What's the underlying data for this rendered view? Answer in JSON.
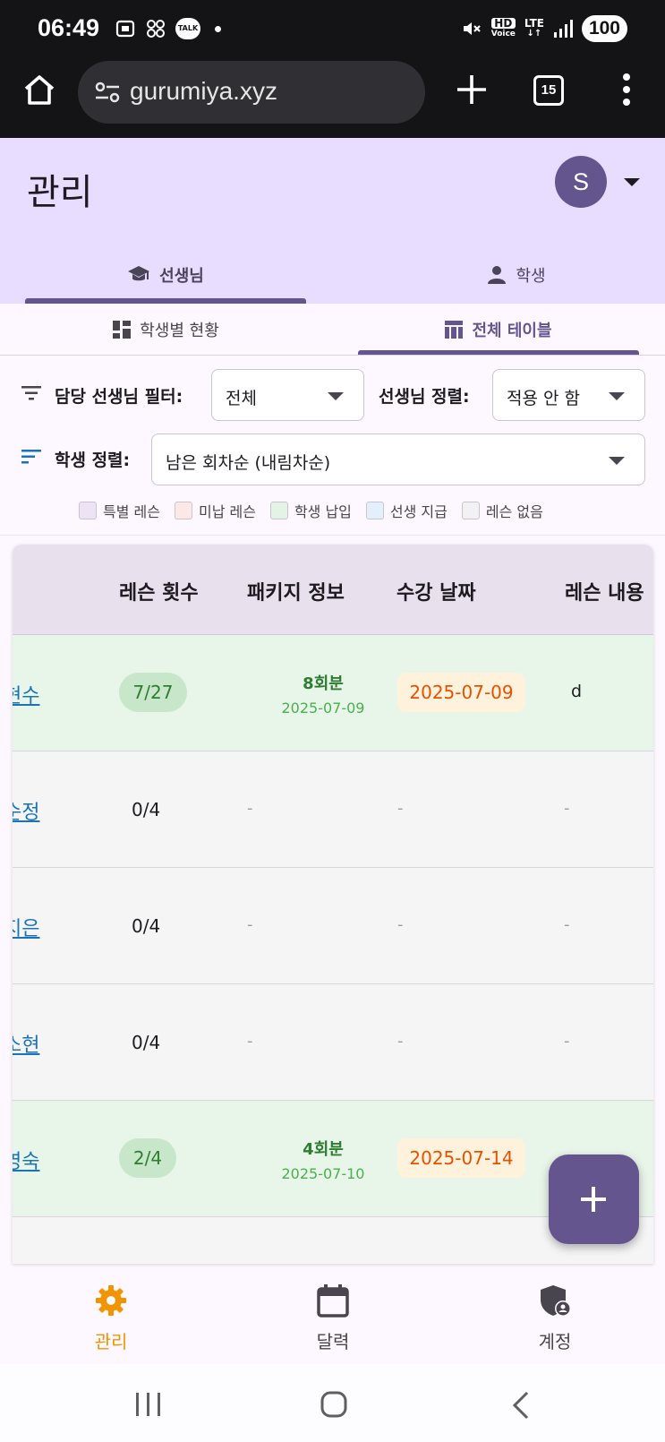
{
  "status": {
    "time": "06:49",
    "talk_label": "TALK",
    "hd_label": "HD",
    "voice_label": "Voice",
    "lte_label": "LTE",
    "battery": "100"
  },
  "browser": {
    "url": "gurumiya.xyz",
    "tab_count": "15"
  },
  "app": {
    "title": "관리",
    "avatar_initial": "S",
    "main_tabs": [
      {
        "label": "선생님",
        "icon": "school-icon",
        "active": true
      },
      {
        "label": "학생",
        "icon": "person-icon",
        "active": false
      }
    ],
    "sub_tabs": [
      {
        "label": "학생별 현황",
        "icon": "dashboard-icon",
        "active": false
      },
      {
        "label": "전체 테이블",
        "icon": "table-icon",
        "active": true
      }
    ]
  },
  "filters": {
    "teacher_filter_label": "담당 선생님 필터:",
    "teacher_filter_value": "전체",
    "teacher_sort_label": "선생님 정렬:",
    "teacher_sort_value": "적용 안 함",
    "student_sort_label": "학생 정렬:",
    "student_sort_value": "남은 회차순 (내림차순)"
  },
  "legend": [
    {
      "label": "특별 레슨",
      "color": "#ede3f5"
    },
    {
      "label": "미납 레슨",
      "color": "#fde8e8"
    },
    {
      "label": "학생 납입",
      "color": "#e3f4e4"
    },
    {
      "label": "선생 지급",
      "color": "#e3effc"
    },
    {
      "label": "레슨 없음",
      "color": "#f2f2f2"
    }
  ],
  "table": {
    "headers": {
      "count": "레슨 횟수",
      "package": "패키지 정보",
      "date": "수강 날짜",
      "content": "레슨 내용"
    },
    "rows": [
      {
        "name": "현수",
        "count": "7/27",
        "package": "8회분",
        "package_date": "2025-07-09",
        "date": "2025-07-09",
        "content": "d",
        "paid": true
      },
      {
        "name": "순정",
        "count": "0/4",
        "package": "-",
        "package_date": "",
        "date": "-",
        "content": "-",
        "paid": false
      },
      {
        "name": "지은",
        "count": "0/4",
        "package": "-",
        "package_date": "",
        "date": "-",
        "content": "-",
        "paid": false
      },
      {
        "name": "소현",
        "count": "0/4",
        "package": "-",
        "package_date": "",
        "date": "-",
        "content": "-",
        "paid": false
      },
      {
        "name": "영숙",
        "count": "2/4",
        "package": "4회분",
        "package_date": "2025-07-10",
        "date": "2025-07-14",
        "content": "",
        "paid": true
      }
    ]
  },
  "bottom_nav": [
    {
      "label": "관리",
      "icon": "gear-icon",
      "active": true
    },
    {
      "label": "달력",
      "icon": "calendar-icon",
      "active": false
    },
    {
      "label": "계정",
      "icon": "shield-account-icon",
      "active": false
    }
  ],
  "colors": {
    "accent": "#65558f",
    "header_bg": "#e9ddff",
    "paid_row": "#e8f5e9",
    "nav_active": "#f29400"
  }
}
